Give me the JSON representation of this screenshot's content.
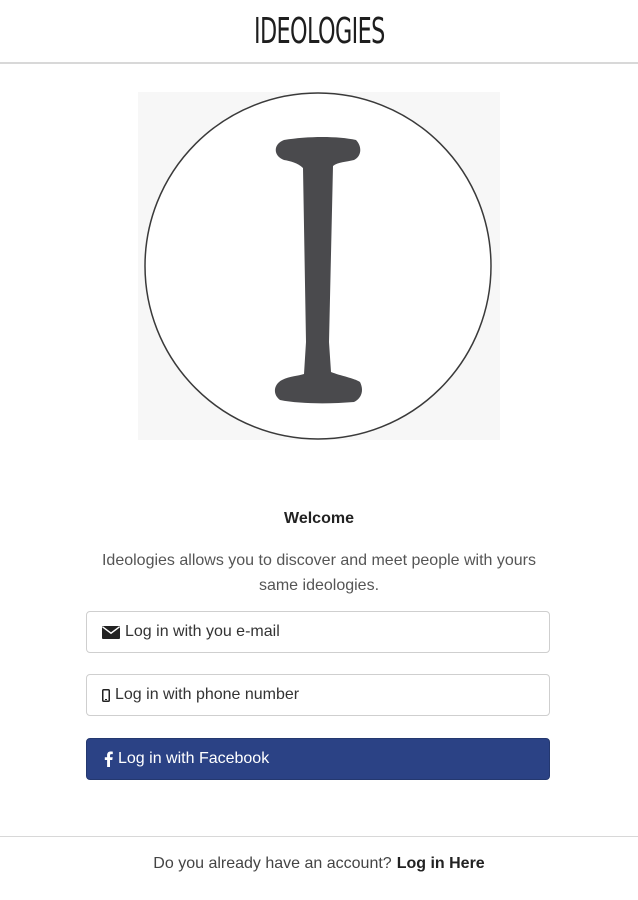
{
  "header": {
    "title": "IDEOLOGIES"
  },
  "logo": {
    "letter": "I",
    "letter_color": "#4a4a4d"
  },
  "main": {
    "welcome": "Welcome",
    "description": "Ideologies allows you to discover and meet people with yours same ideologies."
  },
  "buttons": {
    "email": {
      "label": "Log in with you e-mail",
      "icon": "envelope-icon"
    },
    "phone": {
      "label": "Log in with phone number",
      "icon": "mobile-phone-icon"
    },
    "facebook": {
      "label": "Log in with Facebook",
      "icon": "facebook-icon",
      "color": "#2b4285"
    }
  },
  "footer": {
    "prompt": "Do you already have an account?",
    "link": "Log in Here"
  }
}
